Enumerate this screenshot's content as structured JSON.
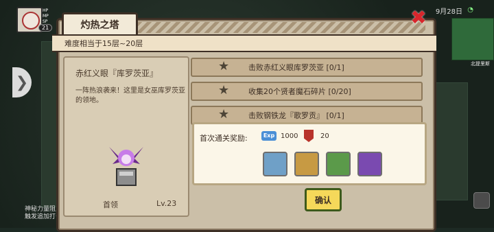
{
  "hud": {
    "hp_label": "HP",
    "mp_label": "MP",
    "sp_label": "SP",
    "level": "21",
    "date": "9月28日",
    "minimap_label": "北提里斯",
    "bottom_text": [
      "神秘力量阻止",
      "触发追加打击"
    ]
  },
  "dialog": {
    "title": "灼热之塔",
    "difficulty": "难度相当于15层~20层",
    "boss": {
      "name": "赤红义眼『库罗茨亚』",
      "description": "一阵热浪袭来！这里是女巫库罗茨亚的领地。",
      "label": "首领",
      "level": "Lv.23"
    },
    "objectives": [
      {
        "text": "击败赤红义眼库罗茨亚 [0/1]"
      },
      {
        "text": "收集20个贤者魔石碎片 [0/20]"
      },
      {
        "text": "击败钢铁龙『歌罗贡』 [0/1]"
      }
    ],
    "rewards": {
      "label": "首次通关奖励:",
      "exp_icon_text": "Exp",
      "exp_value": "1000",
      "honor_value": "20",
      "items": [
        {
          "icon": "ice-staff-icon",
          "color": "#6fa0c7"
        },
        {
          "icon": "guitar-icon",
          "color": "#c79a43"
        },
        {
          "icon": "book-icon",
          "color": "#5b9a4a"
        },
        {
          "icon": "gate-icon",
          "color": "#7a4ab0"
        }
      ]
    },
    "confirm_label": "确认",
    "close_icon": "close-icon"
  }
}
